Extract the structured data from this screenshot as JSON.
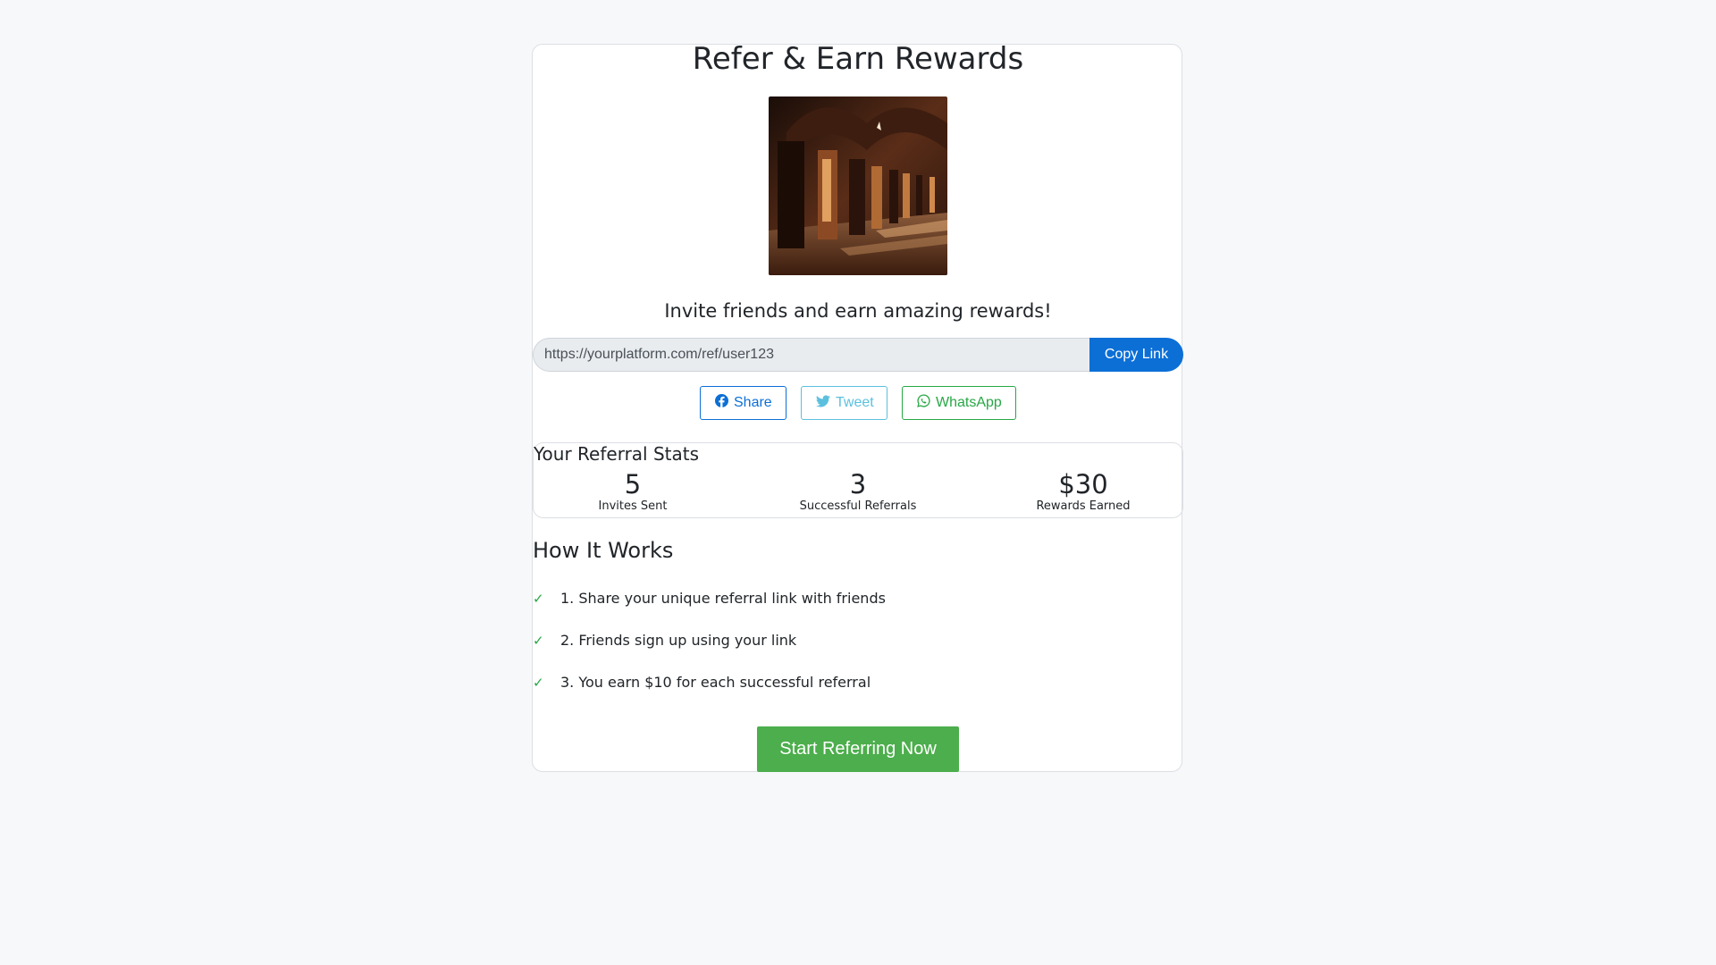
{
  "page": {
    "title": "Refer & Earn Rewards",
    "subtitle": "Invite friends and earn amazing rewards!"
  },
  "referral": {
    "link": "https://yourplatform.com/ref/user123",
    "copy_label": "Copy Link"
  },
  "share": {
    "facebook_label": "Share",
    "twitter_label": "Tweet",
    "whatsapp_label": "WhatsApp"
  },
  "stats": {
    "title": "Your Referral Stats",
    "items": [
      {
        "value": "5",
        "label": "Invites Sent"
      },
      {
        "value": "3",
        "label": "Successful Referrals"
      },
      {
        "value": "$30",
        "label": "Rewards Earned"
      }
    ]
  },
  "how": {
    "title": "How It Works",
    "steps": [
      {
        "check": "✓",
        "text": "1. Share your unique referral link with friends"
      },
      {
        "check": "✓",
        "text": "2. Friends sign up using your link"
      },
      {
        "check": "✓",
        "text": "3. You earn $10 for each successful referral"
      }
    ]
  },
  "cta": {
    "label": "Start Referring Now"
  },
  "colors": {
    "primary": "#0b6fd6",
    "info": "#5bc0de",
    "success": "#28a745",
    "cta": "#4cae4c"
  }
}
